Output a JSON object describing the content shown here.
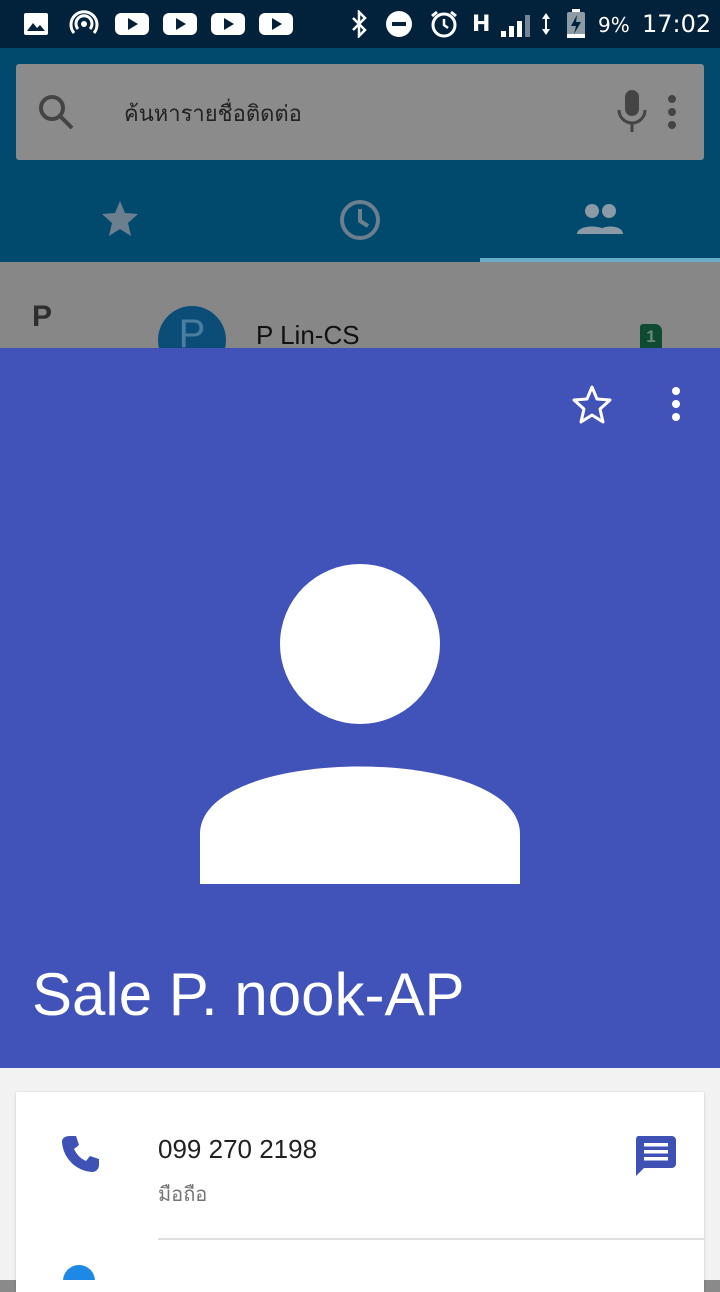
{
  "status_bar": {
    "battery_percent": "9%",
    "time": "17:02",
    "network_type": "H",
    "left_icons": [
      "gallery-icon",
      "hotspot-icon",
      "youtube-icon",
      "youtube-icon",
      "youtube-icon",
      "youtube-icon"
    ],
    "right_icons": [
      "bluetooth-icon",
      "do-not-disturb-icon",
      "alarm-icon",
      "signal-icon",
      "data-arrows-icon",
      "battery-charging-icon"
    ]
  },
  "search": {
    "placeholder": "ค้นหารายชื่อติดต่อ"
  },
  "tabs": [
    {
      "name": "favorites",
      "icon": "star-icon"
    },
    {
      "name": "recents",
      "icon": "clock-icon"
    },
    {
      "name": "contacts",
      "icon": "people-icon",
      "selected": true
    }
  ],
  "contact_list": {
    "section_letter": "P",
    "first_item": {
      "avatar_letter": "P",
      "name": "P Lin-CS",
      "sim_label": "1"
    }
  },
  "contact_card": {
    "name": "Sale P. nook-AP",
    "header_color": "#4152b8",
    "phone": {
      "number": "099 270 2198",
      "type": "มือถือ"
    }
  }
}
